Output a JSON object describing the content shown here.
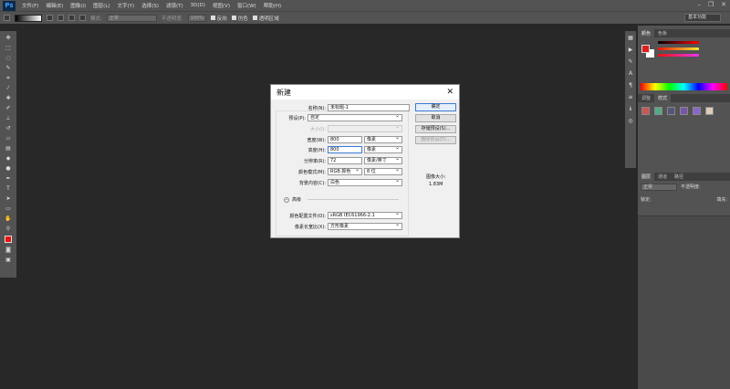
{
  "menubar": {
    "logo": "Ps",
    "items": [
      "文件(F)",
      "编辑(E)",
      "图像(I)",
      "图层(L)",
      "文字(Y)",
      "选择(S)",
      "滤镜(T)",
      "3D(D)",
      "视图(V)",
      "窗口(W)",
      "帮助(H)"
    ],
    "window_controls": [
      "–",
      "❐",
      "✕"
    ]
  },
  "options": {
    "mode_label": "模式:",
    "mode_value": "正常",
    "opacity_label": "不透明度:",
    "opacity_value": "100%",
    "reverse": "反向",
    "dither": "仿色",
    "transparency": "透明区域",
    "workspace": "基本功能"
  },
  "panels": {
    "color_tabs": [
      "颜色",
      "色板"
    ],
    "adjust_tabs": [
      "调整",
      "样式"
    ],
    "layer_tabs": [
      "图层",
      "通道",
      "路径"
    ],
    "blend": "正常",
    "opacity": "不透明度:",
    "lock": "锁定:",
    "fill": "填充:",
    "colors": {
      "foreground": "#e11d1d",
      "background": "#ffffff"
    }
  },
  "dialog": {
    "title": "新建",
    "name_label": "名称(N):",
    "name_value": "未标题-1",
    "preset_label": "预设(P):",
    "preset_value": "自定",
    "size_label": "大小(I):",
    "width_label": "宽度(W):",
    "width_value": "800",
    "width_unit": "像素",
    "height_label": "高度(H):",
    "height_value": "800",
    "height_unit": "像素",
    "resolution_label": "分辨率(R):",
    "resolution_value": "72",
    "resolution_unit": "像素/英寸",
    "color_mode_label": "颜色模式(M):",
    "color_mode_value": "RGB 颜色",
    "bit_depth": "8 位",
    "background_label": "背景内容(C):",
    "background_value": "白色",
    "advanced_label": "高级",
    "profile_label": "颜色配置文件(O):",
    "profile_value": "sRGB IEC61966-2.1",
    "aspect_label": "像素长宽比(X):",
    "aspect_value": "方形像素",
    "ok": "确定",
    "cancel": "取消",
    "save_preset": "存储预设(S)...",
    "delete_preset": "删除预设(D)...",
    "image_size_label": "图像大小:",
    "image_size_value": "1.83M"
  }
}
